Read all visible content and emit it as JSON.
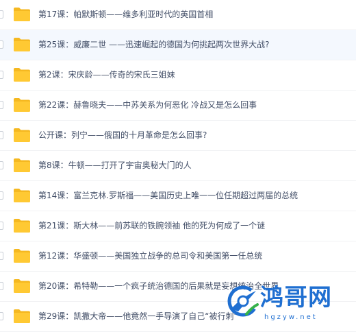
{
  "rows": [
    {
      "name": "第17课：帕默斯顿——维多利亚时代的英国首相",
      "icon": "folder-icon",
      "highlighted": false
    },
    {
      "name": "第25课：威廉二世 ——迅速崛起的德国为何挑起两次世界大战?",
      "icon": "folder-icon",
      "highlighted": true
    },
    {
      "name": "第2课：宋庆龄——传奇的宋氏三姐妹",
      "icon": "folder-icon",
      "highlighted": false
    },
    {
      "name": "第22课：赫鲁晓夫——中苏关系为何恶化 冷战又是怎么回事",
      "icon": "folder-icon",
      "highlighted": false
    },
    {
      "name": "公开课：列宁——俄国的十月革命是怎么回事?",
      "icon": "folder-icon",
      "highlighted": false
    },
    {
      "name": "第8课：牛顿——打开了宇宙奥秘大门的人",
      "icon": "folder-icon",
      "highlighted": false
    },
    {
      "name": "第14课：富兰克林.罗斯福——美国历史上唯一一位任期超过两届的总统",
      "icon": "folder-icon",
      "highlighted": false
    },
    {
      "name": "第21课：斯大林——前苏联的铁腕领袖 他的死为何成了一个谜",
      "icon": "folder-icon",
      "highlighted": false
    },
    {
      "name": "第12课：华盛顿——美国独立战争的总司令和美国第一任总统",
      "icon": "folder-icon",
      "highlighted": false
    },
    {
      "name": "第20课：希特勒——一个疯子统治德国的后果就是妄想统治全世界",
      "icon": "folder-icon",
      "highlighted": false
    },
    {
      "name": "第29课：凯撒大帝——他竟然一手导演了自己“被行刺”",
      "icon": "folder-icon",
      "highlighted": false
    }
  ],
  "colors": {
    "folder": "#ffc933",
    "folder_tab": "#f5b820",
    "text": "#424e67",
    "row_highlight": "#f4f8fe",
    "watermark": "#1f6fd1"
  },
  "watermark": {
    "title": "鸿哥网",
    "url": "hgzyw.net",
    "icon": "watermark-logo"
  }
}
